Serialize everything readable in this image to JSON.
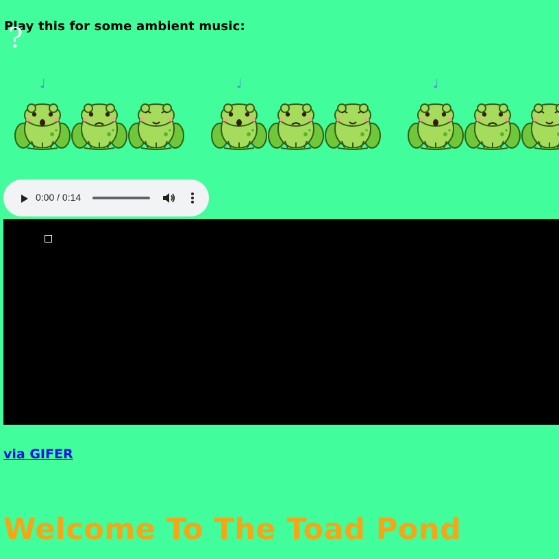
{
  "intro": {
    "text": "Play this for some ambient music:",
    "question_glyph": "?"
  },
  "frog_groups": [
    {
      "note_glyph": "♩"
    },
    {
      "note_glyph": "♩"
    },
    {
      "note_glyph": "♩"
    }
  ],
  "audio_player": {
    "time_display": "0:00 / 0:14",
    "icons": [
      "play-icon",
      "volume-icon",
      "more-options-icon"
    ]
  },
  "video": {
    "broken_image_glyph": ""
  },
  "credit_link": {
    "label": "via GIFER"
  },
  "heading": {
    "text": "Welcome To The Toad Pond"
  },
  "colors": {
    "background": "#41fd9b",
    "heading": "#f6a516",
    "link": "#1212ee",
    "player_bg": "#f1f3f4",
    "video_bg": "#000000",
    "note": "#4a8ad6"
  }
}
